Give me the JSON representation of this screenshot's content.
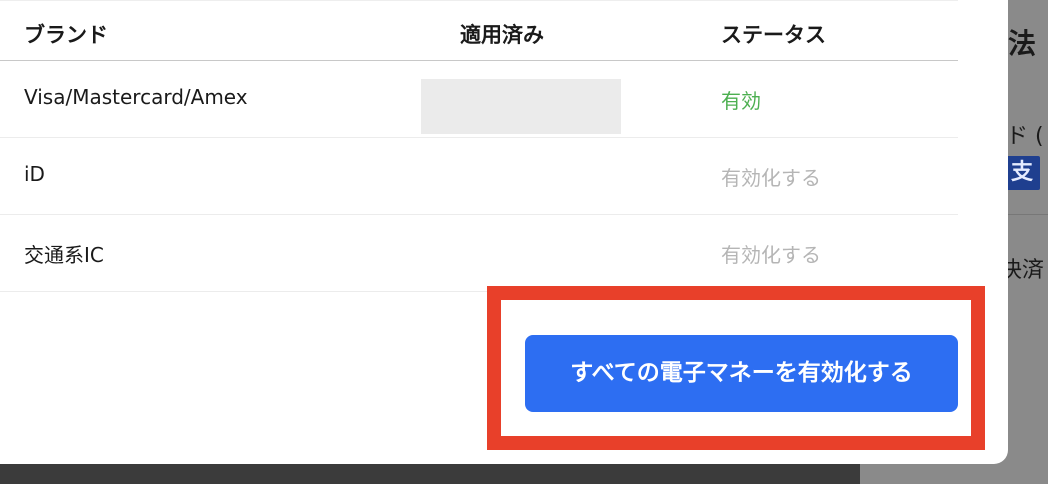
{
  "background": {
    "title": "法",
    "card_label": "ド (",
    "badge": "支",
    "settled": "決済"
  },
  "table": {
    "headers": {
      "brand": "ブランド",
      "applied": "適用済み",
      "status": "ステータス"
    },
    "rows": [
      {
        "brand": "Visa/Mastercard/Amex",
        "status": "有効"
      },
      {
        "brand": "iD",
        "status": "有効化する"
      },
      {
        "brand": "交通系IC",
        "status": "有効化する"
      }
    ]
  },
  "actions": {
    "enable_all_label": "すべての電子マネーを有効化する"
  },
  "colors": {
    "accent": "#2d6ef2",
    "active": "#4caf50",
    "highlight": "#e8402a"
  }
}
